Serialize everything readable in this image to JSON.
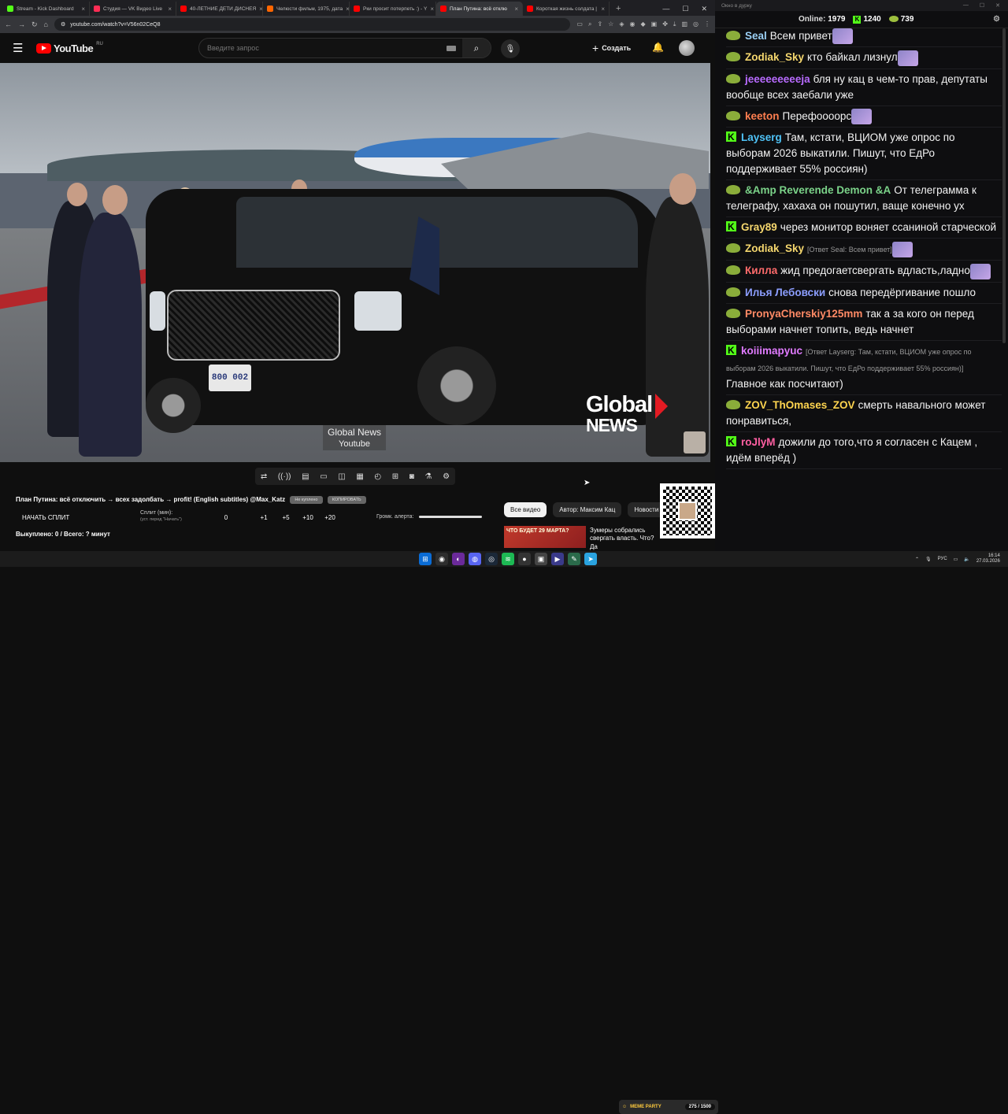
{
  "browser": {
    "tabs": [
      {
        "label": "Stream - Kick Dashboard",
        "color": "#53fc18",
        "active": false
      },
      {
        "label": "Студия — VK Видео Live",
        "color": "#ff2d55",
        "active": false
      },
      {
        "label": "40-ЛЕТНИЕ ДЕТИ ДИСНЕЯ",
        "color": "#ff0000",
        "active": false
      },
      {
        "label": "Челюсти фильм, 1975, дата",
        "color": "#ff6600",
        "active": false
      },
      {
        "label": "Рки просит потерпеть :) - Y",
        "color": "#ff0000",
        "active": false
      },
      {
        "label": "План Путина: всё отклю",
        "color": "#ff0000",
        "active": true
      },
      {
        "label": "Короткая жизнь солдата | ",
        "color": "#ff0000",
        "active": false
      }
    ],
    "url": "youtube.com/watch?v=V56n02CeQ8"
  },
  "youtube": {
    "logo_text": "YouTube",
    "region": "RU",
    "search_placeholder": "Введите запрос",
    "create_label": "Создать"
  },
  "video": {
    "plate": "800 002",
    "brand_line1": "Global",
    "brand_line2": "NEWS",
    "watermark_line1": "Global News",
    "watermark_line2": "Youtube"
  },
  "info": {
    "title": "План Путина: всё отключить → всех задолбать → profit! (English subtitles) @Max_Katz",
    "pill1": "Не куплено",
    "pill2": "КОПИРОВАТЬ",
    "split_button": "НАЧАТЬ СПЛИТ",
    "split_label": "Сплит (мин):",
    "split_sub": "(уст. перед \"Начать\")",
    "nums": [
      "0",
      "+1",
      "+5",
      "+10",
      "+20"
    ],
    "alert_label": "Громк. алерта:",
    "bought": "Выкуплено: 0 / Всего: ? минут"
  },
  "chips": [
    "Все видео",
    "Автор: Максим Кац",
    "Новости"
  ],
  "rec": {
    "thumb_text": "ЧТО БУДЕТ 29 МАРТА?",
    "title": "Зумеры собрались свергать власть. Что? Да"
  },
  "chat_window": {
    "title": "Окно в дурку",
    "online_label": "Online:",
    "online": "1979",
    "kick_count": "1240",
    "pepe_count": "739"
  },
  "chat": [
    {
      "badge": "pepe",
      "nick": "Seal",
      "color": "#9bd0f5",
      "reply": "",
      "text": "Всем привет",
      "emote": true
    },
    {
      "badge": "pepe",
      "nick": "Zodiak_Sky",
      "color": "#f5d76e",
      "reply": "",
      "text": "кто байкал лизнул",
      "emote": true
    },
    {
      "badge": "pepe",
      "nick": "jeeeeeeeeeja",
      "color": "#b86bff",
      "reply": "",
      "text": "бля ну кац в чем-то прав, депутаты вообще всех заебали уже",
      "emote": false
    },
    {
      "badge": "pepe",
      "nick": "keeton",
      "color": "#ff7f50",
      "reply": "",
      "text": "Перефоооорс",
      "emote": true
    },
    {
      "badge": "kick",
      "nick": "Layserg",
      "color": "#4fc3f7",
      "reply": "",
      "text": "Там, кстати, ВЦИОМ уже опрос по выборам 2026 выкатили. Пишут, что ЕдРо поддерживает 55% россиян)",
      "emote": false
    },
    {
      "badge": "pepe",
      "nick": "&Amp Reverende Demon &A",
      "color": "#7bd389",
      "reply": "",
      "text": "От телеграмма к телеграфу, хахаха он пошутил, ваще конечно ух",
      "emote": false
    },
    {
      "badge": "kick",
      "nick": "Gray89",
      "color": "#f5d76e",
      "reply": "",
      "text": "через монитор воняет ссаниной старческой",
      "emote": false
    },
    {
      "badge": "pepe",
      "nick": "Zodiak_Sky",
      "color": "#f5d76e",
      "reply": "[Ответ Seal: Всем привет]",
      "text": "",
      "emote": true
    },
    {
      "badge": "pepe",
      "nick": "Килла",
      "color": "#ff6b6b",
      "reply": "",
      "text": "жид предогаетсвергать вдласть,ладно",
      "emote": true
    },
    {
      "badge": "pepe",
      "nick": "Илья Лебовски",
      "color": "#8c9eff",
      "reply": "",
      "text": "снова передёргивание пошло",
      "emote": false
    },
    {
      "badge": "pepe",
      "nick": "PronyaCherskiy125mm",
      "color": "#ff8a65",
      "reply": "",
      "text": "так а за кого он перед выборами начнет топить, ведь начнет",
      "emote": false
    },
    {
      "badge": "kick",
      "nick": "koiiimapyuc",
      "color": "#e07bff",
      "reply": "[Ответ Layserg: Там, кстати, ВЦИОМ уже опрос по выборам 2026 выкатили. Пишут, что ЕдРо поддерживает 55% россиян)]",
      "text": "Главное как посчитают)",
      "emote": false
    },
    {
      "badge": "pepe",
      "nick": "ZOV_ThOmases_ZOV",
      "color": "#ffd54f",
      "reply": "",
      "text": "смерть навального может понравиться,",
      "emote": false
    },
    {
      "badge": "kick",
      "nick": "roJlyM",
      "color": "#ff5fa2",
      "reply": "",
      "text": "дожили до того,что я согласен с Кацем , идём вперёд )",
      "emote": false
    }
  ],
  "taskbar": {
    "meme_label": "MEME PARTY",
    "meme_count": "275 / 1500",
    "lang": "РУС",
    "time": "16:14",
    "date": "27.03.2026"
  }
}
